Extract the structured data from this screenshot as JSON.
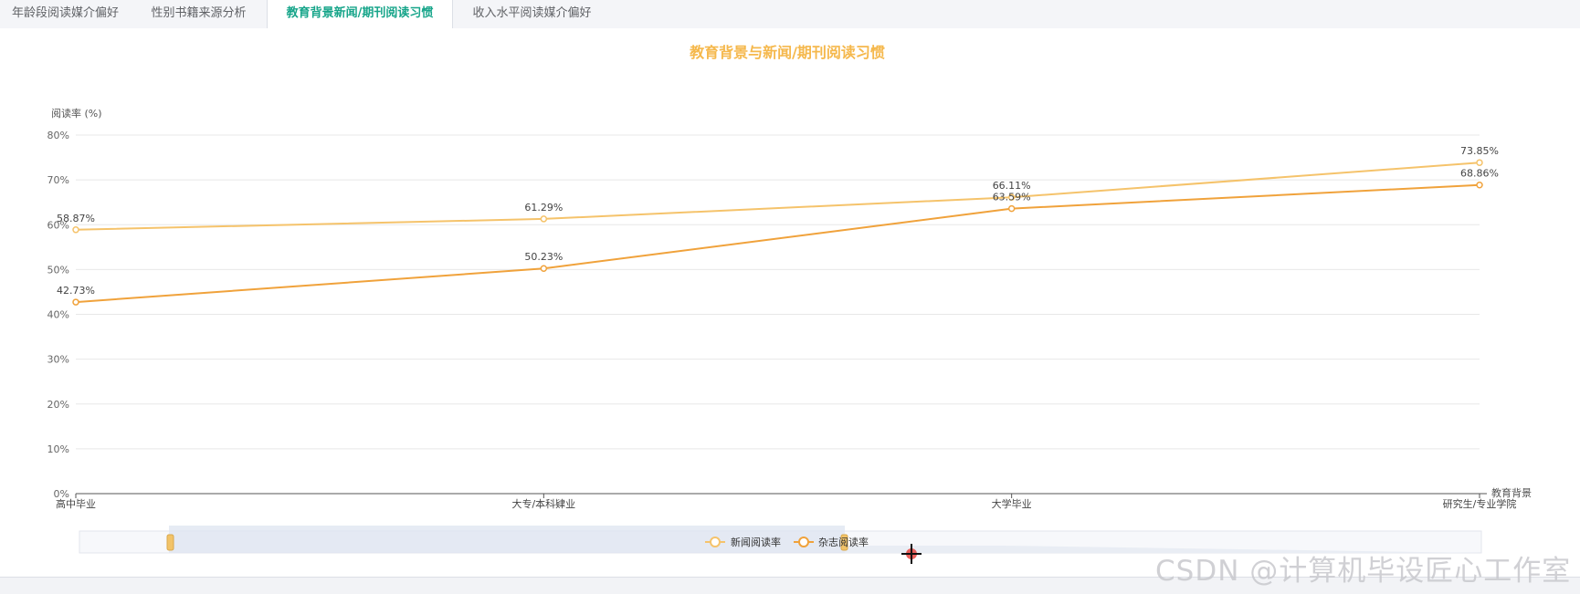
{
  "tabs": [
    {
      "label": "年龄段阅读媒介偏好",
      "active": false
    },
    {
      "label": "性别书籍来源分析",
      "active": false
    },
    {
      "label": "教育背景新闻/期刊阅读习惯",
      "active": true
    },
    {
      "label": "收入水平阅读媒介偏好",
      "active": false
    }
  ],
  "chart_data": {
    "type": "line",
    "title": "教育背景与新闻/期刊阅读习惯",
    "xlabel": "教育背景",
    "ylabel": "阅读率 (%)",
    "categories": [
      "高中毕业",
      "大专/本科肄业",
      "大学毕业",
      "研究生/专业学院"
    ],
    "ylim": [
      0,
      80
    ],
    "yticks": [
      "0%",
      "10%",
      "20%",
      "30%",
      "40%",
      "50%",
      "60%",
      "70%",
      "80%"
    ],
    "series": [
      {
        "name": "新闻阅读率",
        "values": [
          58.87,
          61.29,
          66.11,
          73.85
        ],
        "labels": [
          "58.87%",
          "61.29%",
          "66.11%",
          "73.85%"
        ],
        "color": "#f5c36b"
      },
      {
        "name": "杂志阅读率",
        "values": [
          42.73,
          50.23,
          63.59,
          68.86
        ],
        "labels": [
          "42.73%",
          "50.23%",
          "63.59%",
          "68.86%"
        ],
        "color": "#f0a23b"
      }
    ],
    "title_color": "#f5b84c",
    "grid": true,
    "legend_position": "bottom-center"
  },
  "watermark": "CSDN @计算机毕设匠心工作室"
}
